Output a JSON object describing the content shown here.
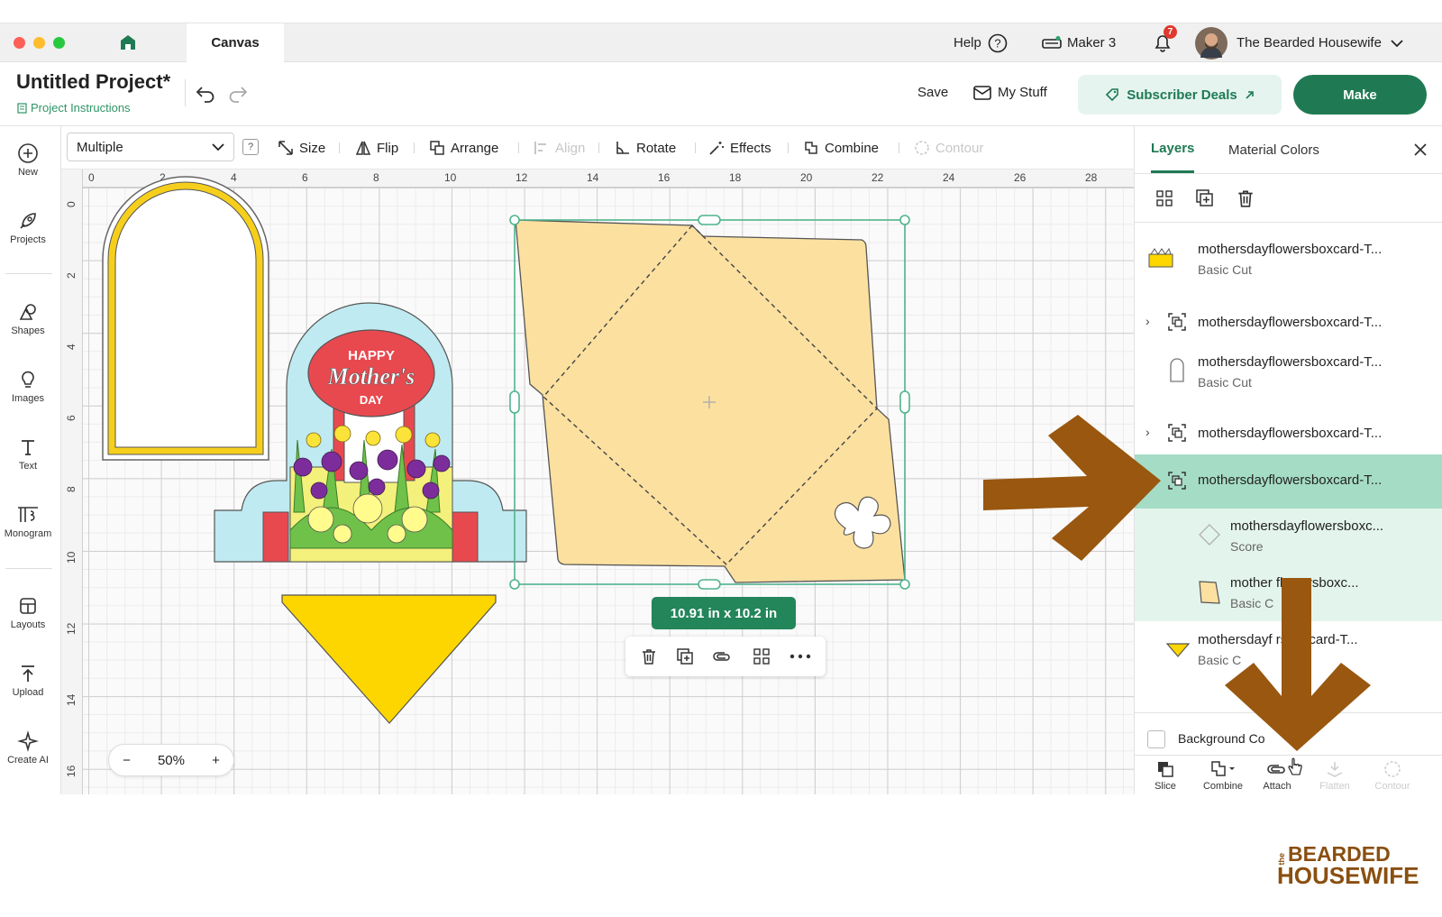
{
  "titlebar": {
    "tab": "Canvas",
    "help": "Help",
    "machine": "Maker 3",
    "notifications": "7",
    "user": "The Bearded Housewife"
  },
  "project": {
    "title": "Untitled Project*",
    "instructions": "Project Instructions",
    "save": "Save",
    "my_stuff": "My Stuff",
    "subscriber_deals": "Subscriber Deals",
    "make": "Make"
  },
  "sidebar": [
    "New",
    "Projects",
    "Shapes",
    "Images",
    "Text",
    "Monogram",
    "Layouts",
    "Upload",
    "Create AI"
  ],
  "toolbar": {
    "select_value": "Multiple",
    "help": "?",
    "size": "Size",
    "flip": "Flip",
    "arrange": "Arrange",
    "align": "Align",
    "rotate": "Rotate",
    "effects": "Effects",
    "combine": "Combine",
    "contour": "Contour"
  },
  "canvas": {
    "ruler_x": [
      "0",
      "2",
      "4",
      "6",
      "8",
      "10",
      "12",
      "14",
      "16",
      "18",
      "20",
      "22",
      "24",
      "26",
      "28"
    ],
    "ruler_y": [
      "0",
      "2",
      "4",
      "6",
      "8",
      "10",
      "12",
      "14",
      "16"
    ],
    "zoom_minus": "−",
    "zoom": "50%",
    "zoom_plus": "+",
    "dimensions": "10.91  in x 10.2  in",
    "card_text": {
      "happy": "HAPPY",
      "mothers": "Mother's",
      "day": "DAY"
    }
  },
  "panel": {
    "tab_layers": "Layers",
    "tab_colors": "Material Colors",
    "layers": [
      {
        "name": "mothersdayflowersboxcard-T...",
        "op": "Basic Cut"
      },
      {
        "name": "mothersdayflowersboxcard-T...",
        "op": ""
      },
      {
        "name": "mothersdayflowersboxcard-T...",
        "op": "Basic Cut"
      },
      {
        "name": "mothersdayflowersboxcard-T...",
        "op": ""
      },
      {
        "name": "mothersdayflowersboxcard-T...",
        "op": ""
      },
      {
        "name": "mothersdayflowersboxc...",
        "op": "Score"
      },
      {
        "name": "mother  flowersboxc...",
        "op": "Basic C"
      },
      {
        "name": "mothersdayf   rsboxcard-T...",
        "op": "Basic C"
      }
    ],
    "background": "Background Co",
    "bottom": [
      "Slice",
      "Combine",
      "Attach",
      "Flatten",
      "Contour"
    ]
  },
  "brand": {
    "line1": "BEARDED",
    "line2": "HOUSEWIFE",
    "prefix": "the"
  },
  "colors": {
    "accent": "#1f7a53",
    "arrow": "#99570f",
    "envelope": "#fbe0a0",
    "yellow": "#fdd600"
  }
}
